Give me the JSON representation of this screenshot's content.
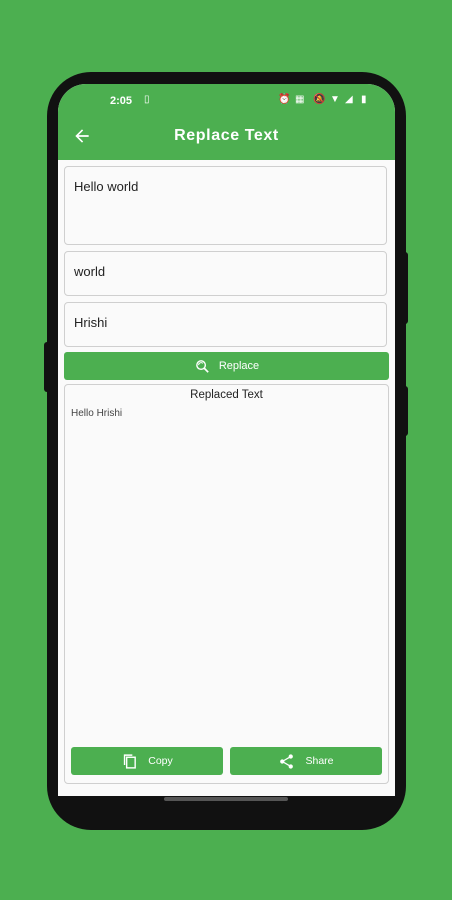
{
  "status": {
    "time": "2:05"
  },
  "appbar": {
    "title": "Replace Text"
  },
  "input": {
    "text": "Hello world"
  },
  "find": {
    "value": "world"
  },
  "replace_with": {
    "value": "Hrishi"
  },
  "replace_button": {
    "label": "Replace"
  },
  "result": {
    "heading": "Replaced Text",
    "text": "Hello Hrishi"
  },
  "actions": {
    "copy_label": "Copy",
    "share_label": "Share"
  },
  "colors": {
    "accent": "#4caf50",
    "background": "#4caf50",
    "surface": "#fafafa"
  }
}
